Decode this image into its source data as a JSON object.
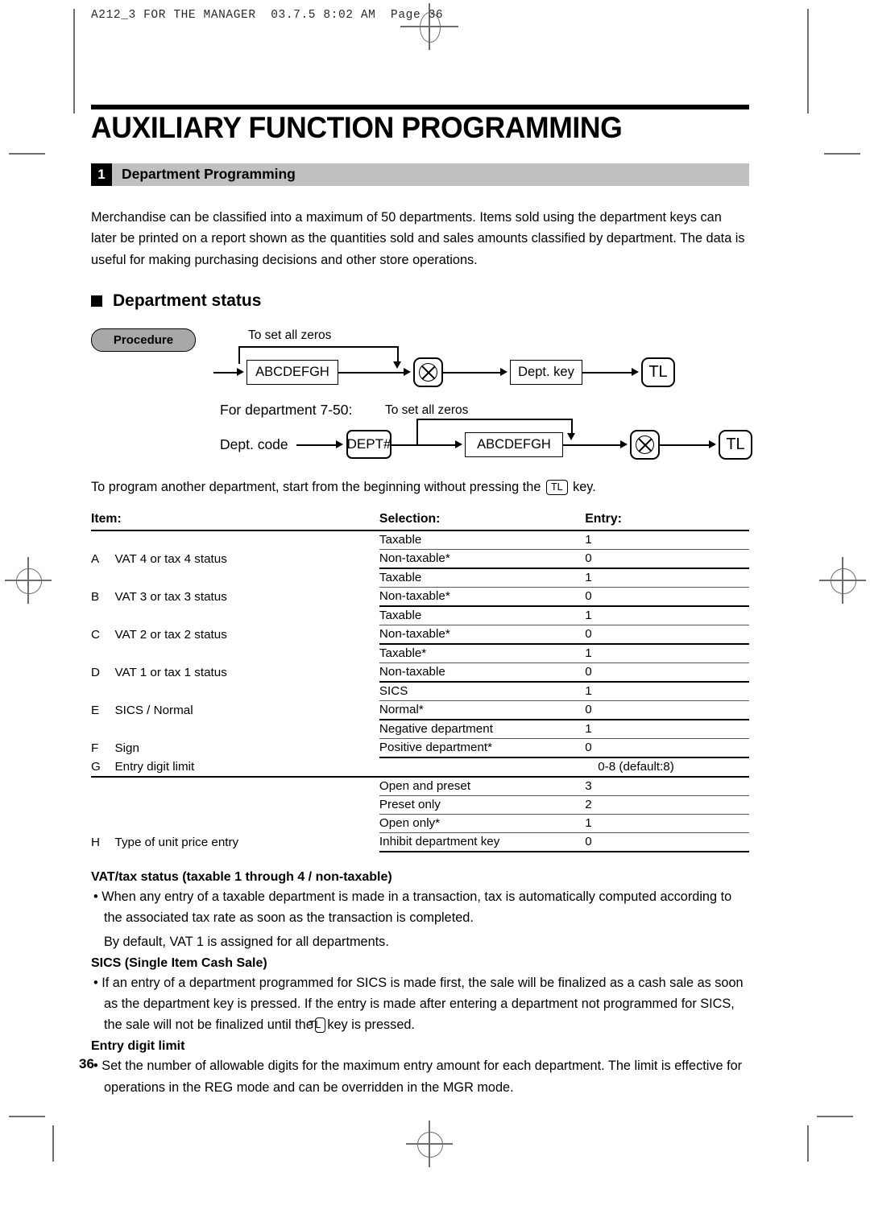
{
  "page_header": "A212_3 FOR THE MANAGER  03.7.5 8:02 AM  Page 36",
  "doc": {
    "title": "AUXILIARY FUNCTION PROGRAMMING",
    "folio": "36"
  },
  "section": {
    "number": "1",
    "title": "Department Programming",
    "intro": "Merchandise can be classified into a maximum of 50 departments.  Items sold using the department keys can later be printed on a report shown as the quantities sold and sales amounts classified by department.  The data is useful for making purchasing decisions and other store operations.",
    "subheading": "Department status"
  },
  "procedure": {
    "label": "Procedure",
    "flow1": {
      "zeros_note": "To set all zeros",
      "code_box": "ABCDEFGH",
      "multiply_key": "multiply-key-icon",
      "dept_key": "Dept. key",
      "total_key": "TL"
    },
    "flow2": {
      "intro": "For department 7-50:",
      "dept_code": "Dept. code",
      "dept_num_key": "DEPT#",
      "zeros_note": "To set all zeros",
      "code_box": "ABCDEFGH",
      "multiply_key": "multiply-key-icon",
      "total_key": "TL"
    },
    "footnote_before": "To program another department, start from the beginning without pressing the",
    "footnote_key": "TL",
    "footnote_after": "key."
  },
  "table": {
    "headers": {
      "item": "Item:",
      "selection": "Selection:",
      "entry": "Entry:"
    },
    "rows": [
      {
        "letter": "A",
        "item": "VAT 4 or tax 4 status",
        "options": [
          {
            "selection": "Taxable",
            "entry": "1"
          },
          {
            "selection": "Non-taxable*",
            "entry": "0"
          }
        ]
      },
      {
        "letter": "B",
        "item": "VAT 3 or tax 3 status",
        "options": [
          {
            "selection": "Taxable",
            "entry": "1"
          },
          {
            "selection": "Non-taxable*",
            "entry": "0"
          }
        ]
      },
      {
        "letter": "C",
        "item": "VAT 2 or tax 2 status",
        "options": [
          {
            "selection": "Taxable",
            "entry": "1"
          },
          {
            "selection": "Non-taxable*",
            "entry": "0"
          }
        ]
      },
      {
        "letter": "D",
        "item": "VAT 1 or tax 1 status",
        "options": [
          {
            "selection": "Taxable*",
            "entry": "1"
          },
          {
            "selection": "Non-taxable",
            "entry": "0"
          }
        ]
      },
      {
        "letter": "E",
        "item": "SICS / Normal",
        "options": [
          {
            "selection": "SICS",
            "entry": "1"
          },
          {
            "selection": "Normal*",
            "entry": "0"
          }
        ]
      },
      {
        "letter": "F",
        "item": "Sign",
        "options": [
          {
            "selection": "Negative department",
            "entry": "1"
          },
          {
            "selection": "Positive department*",
            "entry": "0"
          }
        ]
      },
      {
        "letter": "G",
        "item": "Entry digit limit",
        "options": [
          {
            "selection": "",
            "entry": "0-8 (default:8)"
          }
        ]
      },
      {
        "letter": "H",
        "item": "Type of unit price entry",
        "options": [
          {
            "selection": "Open and preset",
            "entry": "3"
          },
          {
            "selection": "Preset only",
            "entry": "2"
          },
          {
            "selection": "Open only*",
            "entry": "1"
          },
          {
            "selection": "Inhibit department key",
            "entry": "0"
          }
        ]
      }
    ]
  },
  "notes": {
    "vat": {
      "heading": "VAT/tax status (taxable 1 through 4 / non-taxable)",
      "bullet": "When any entry of a taxable department is made in a transaction, tax is automatically computed according to the associated tax rate as soon as the transaction is completed.",
      "continuation": "By default, VAT 1 is assigned for all departments."
    },
    "sics": {
      "heading": "SICS (Single Item Cash Sale)",
      "bullet_part1": "If an entry of a department programmed for SICS is made first, the sale will be finalized as a cash sale as soon as the department key is pressed.  If the entry is made after entering a department not programmed for SICS, the sale will not be finalized until the",
      "bullet_key": "TL",
      "bullet_part2": "key is pressed."
    },
    "digit": {
      "heading": "Entry digit limit",
      "bullet": "Set the number of allowable digits for the maximum entry amount for each department.  The limit is effective for operations in the REG mode and can be overridden in the MGR mode."
    }
  }
}
